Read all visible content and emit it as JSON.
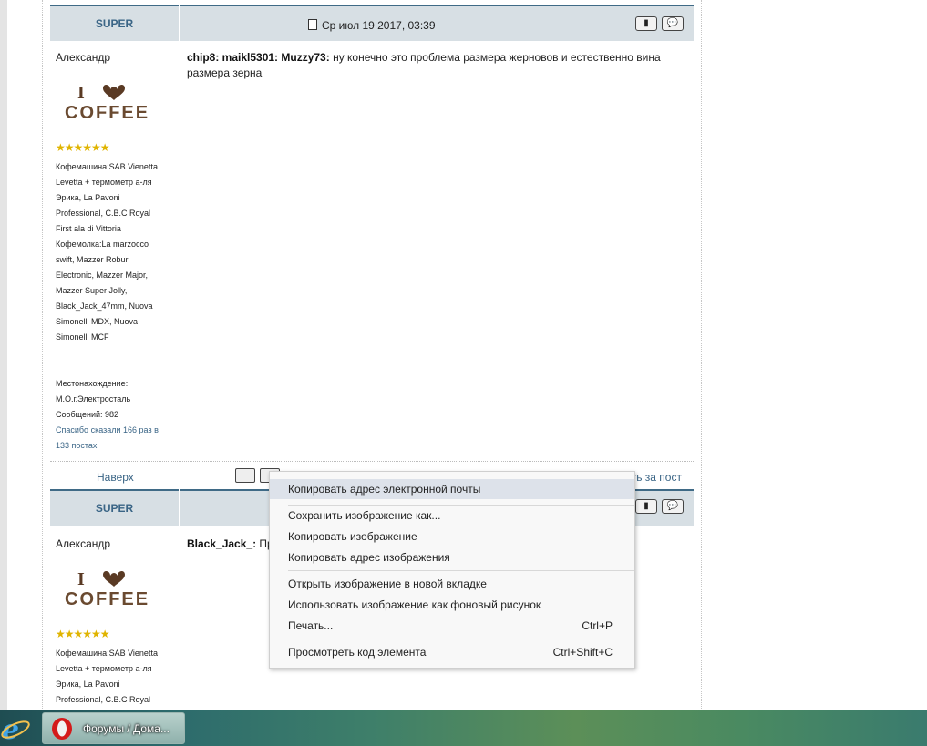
{
  "post1": {
    "rank": "SUPER",
    "date": "Ср июл 19 2017, 03:39",
    "author": "Александр",
    "stars": "★★★★★★",
    "info_lines": [
      "Кофемашина:SAB Vienetta",
      "Levetta + термометр а-ля",
      "Эрика, La Pavoni",
      "Professional, C.B.C Royal",
      "First ala di Vittoria",
      "Кофемолка:La marzocco",
      "swift, Mazzer Robur",
      "Electronic, Mazzer Major,",
      "Mazzer Super Jolly,",
      "Black_Jack_47mm, Nuova",
      "Simonelli MDX, Nuova",
      "Simonelli MCF"
    ],
    "location_label": "Местонахождение:",
    "location_value": "М.О.г.Электросталь",
    "messages": "Сообщений: 982",
    "thanks_1": "Спасибо сказали 166 раз в",
    "thanks_2": "133 постах",
    "msg_names": "chip8: maikl5301: Muzzy73:",
    "msg_text_1": " ну конечно это проблема размера жерновов и естественно вина",
    "msg_text_2": "размера зерна"
  },
  "footer": {
    "top_link": "Наверх",
    "right_link": "ить за пост"
  },
  "post2": {
    "rank": "SUPER",
    "author": "Александр",
    "stars": "★★★★★★",
    "info_lines": [
      "Кофемашина:SAB Vienetta",
      "Levetta + термометр а-ля",
      "Эрика, La Pavoni",
      "Professional, C.B.C Royal"
    ],
    "msg_name": "Black_Jack_:",
    "msg_text": " Пр"
  },
  "coffee_logo": {
    "line1": "I",
    "line2": "COFFEE"
  },
  "context_menu": {
    "items": [
      {
        "label": "Копировать адрес электронной почты",
        "shortcut": ""
      },
      {
        "label": "Сохранить изображение как...",
        "shortcut": ""
      },
      {
        "label": "Копировать изображение",
        "shortcut": ""
      },
      {
        "label": "Копировать адрес изображения",
        "shortcut": ""
      },
      {
        "label": "Открыть изображение в новой вкладке",
        "shortcut": ""
      },
      {
        "label": "Использовать изображение как фоновый рисунок",
        "shortcut": ""
      },
      {
        "label": "Печать...",
        "shortcut": "Ctrl+P"
      },
      {
        "label": "Просмотреть код элемента",
        "shortcut": "Ctrl+Shift+C"
      }
    ]
  },
  "taskbar": {
    "task_label": "Форумы / Дома..."
  },
  "colors": {
    "header_bg": "#d7dfe4",
    "accent": "#3f6a86",
    "link": "#3a6586",
    "menu_highlight": "#dde2ea"
  }
}
